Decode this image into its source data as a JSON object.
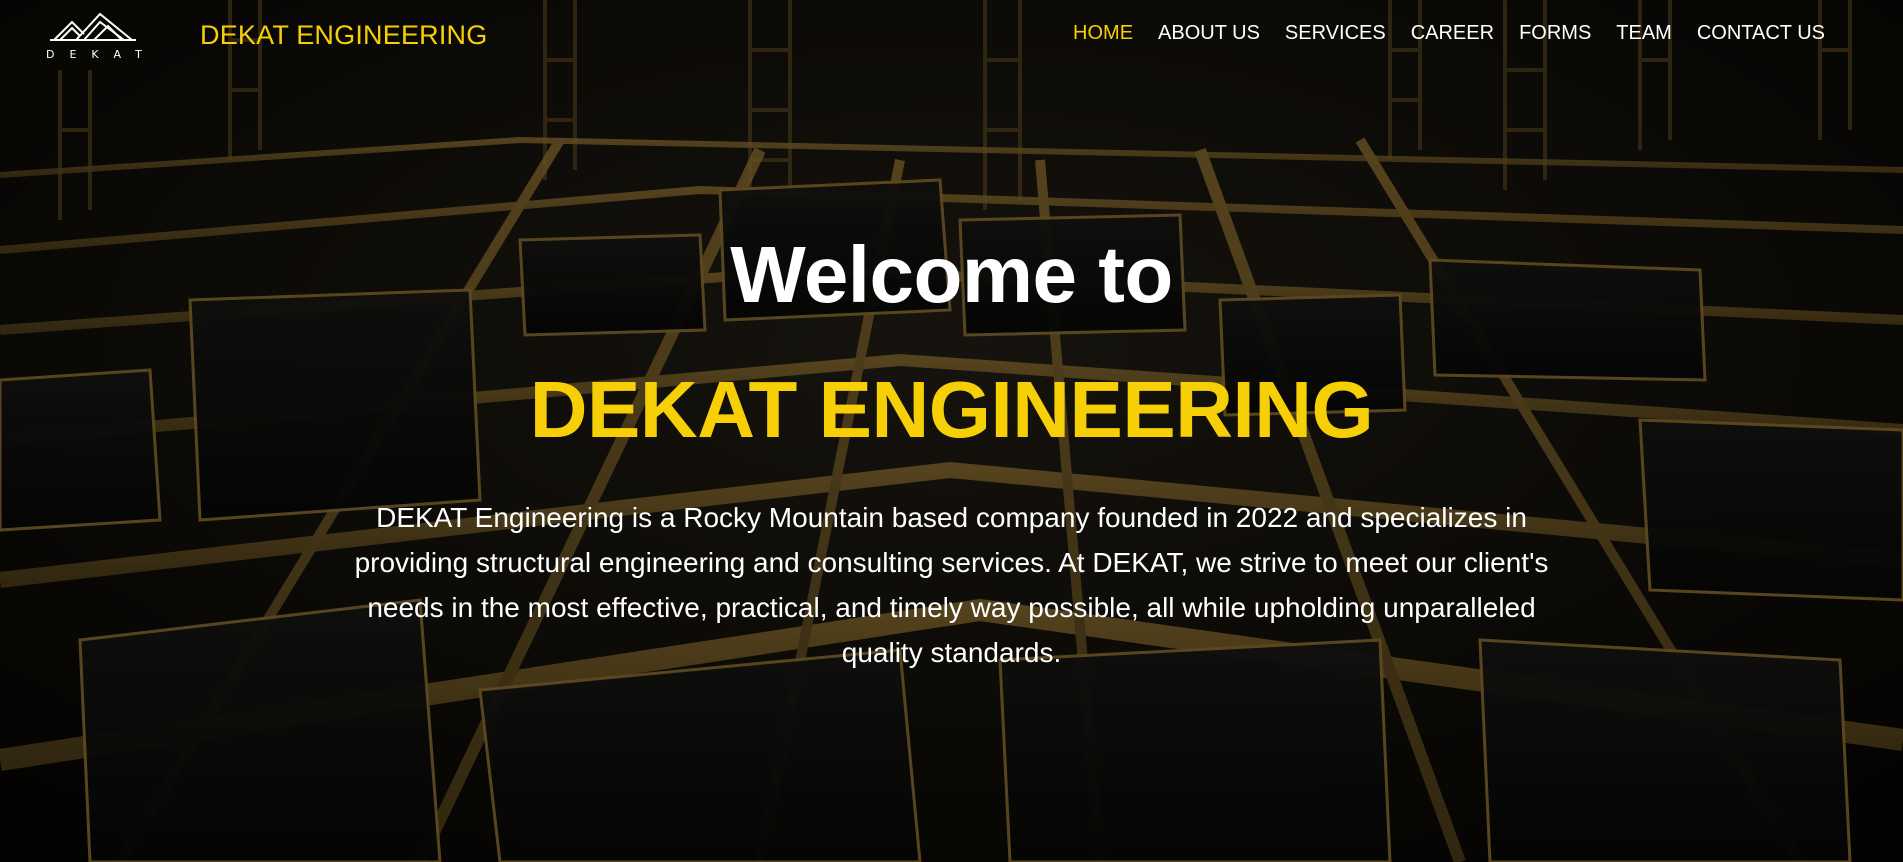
{
  "header": {
    "logo_text": "DEKAT",
    "brand_name": "DEKAT ENGINEERING",
    "nav": [
      {
        "label": "HOME",
        "active": true
      },
      {
        "label": "ABOUT US",
        "active": false
      },
      {
        "label": "SERVICES",
        "active": false
      },
      {
        "label": "CAREER",
        "active": false
      },
      {
        "label": "FORMS",
        "active": false
      },
      {
        "label": "TEAM",
        "active": false
      },
      {
        "label": "CONTACT US",
        "active": false
      }
    ]
  },
  "hero": {
    "welcome": "Welcome to",
    "title": "DEKAT ENGINEERING",
    "description": "DEKAT Engineering is a Rocky Mountain based company founded in 2022 and specializes in providing structural engineering and consulting services. At DEKAT, we strive to meet our client's needs in the most effective, practical, and timely way possible, all while upholding unparalleled quality standards."
  },
  "colors": {
    "accent": "#f6cf06",
    "text": "#ffffff",
    "background": "#0d0b07"
  }
}
